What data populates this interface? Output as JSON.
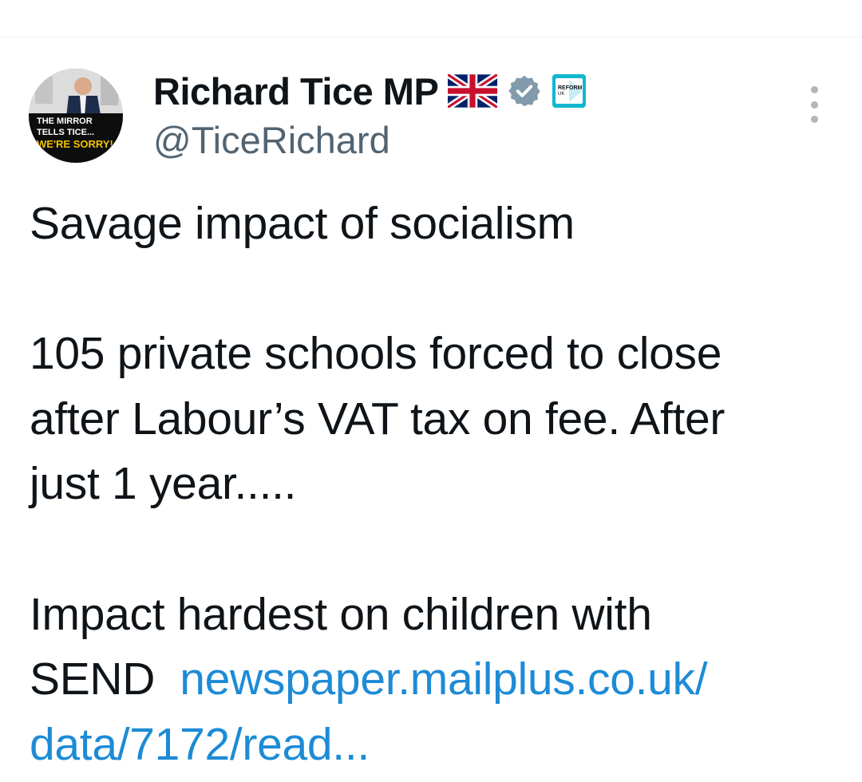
{
  "tweet": {
    "author": {
      "display_name": "Richard Tice MP",
      "handle": "@TiceRichard",
      "badges": [
        "uk-flag-icon",
        "verified-icon",
        "reform-uk-logo"
      ],
      "reform_logo_text": [
        "REFORM",
        "UK"
      ],
      "avatar_caption": [
        "THE MIRROR",
        "TELLS TICE...",
        "WE'RE SORRY!"
      ]
    },
    "text_lines": [
      "Savage impact of socialism",
      "",
      "105 private schools forced to close",
      "after Labour’s VAT tax on fee. After",
      "just 1 year.....",
      "",
      "Impact hardest on children with",
      "SEND  "
    ],
    "link": {
      "line1": "newspaper.mailplus.co.uk/",
      "line2": "data/7172/read..."
    },
    "more_icon": "more-options-icon"
  },
  "colors": {
    "text": "#0f1419",
    "secondary_text": "#536471",
    "link": "#1d8bd6",
    "verified_badge": "#829aab",
    "reform_blue": "#12b6cf"
  }
}
